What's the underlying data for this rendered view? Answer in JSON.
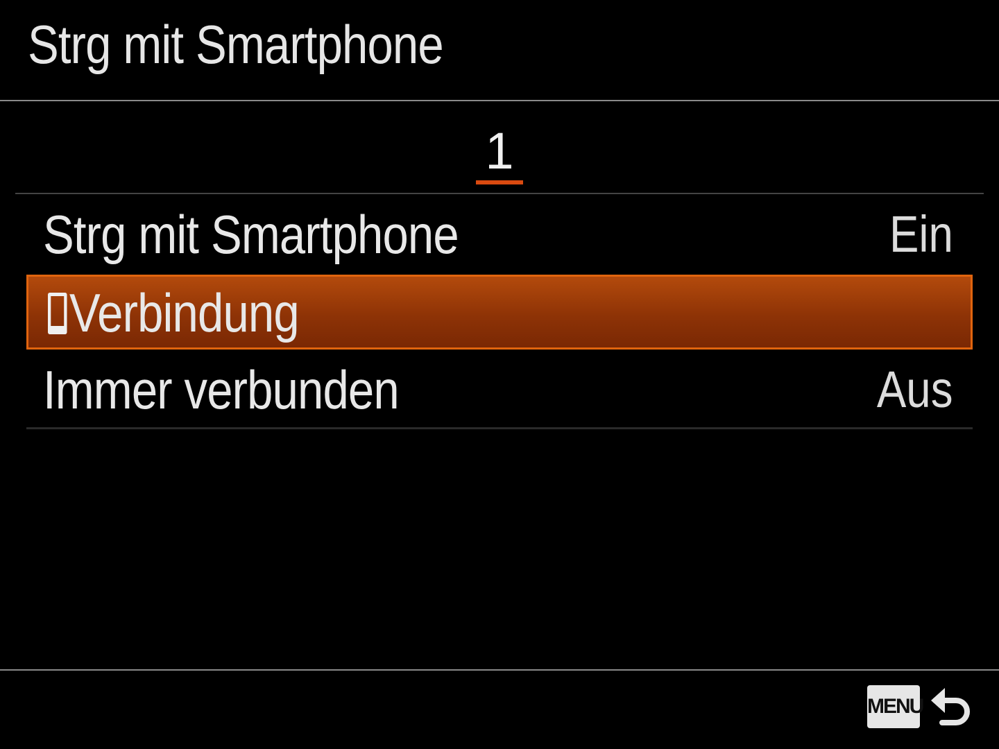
{
  "header": {
    "title": "Strg mit Smartphone"
  },
  "tabs": {
    "current_page": "1"
  },
  "menu": {
    "items": [
      {
        "label": "Strg mit Smartphone",
        "value": "Ein"
      },
      {
        "label": "Verbindung",
        "value": "",
        "icon": "phone-icon"
      },
      {
        "label": "Immer verbunden",
        "value": "Aus"
      }
    ],
    "selected_index": 1
  },
  "footer": {
    "menu_label": "MENU",
    "back_icon": "back-arrow-icon"
  },
  "colors": {
    "accent": "#d94a10",
    "selection_bg": "#8e3306",
    "selection_border": "#e0640e"
  }
}
